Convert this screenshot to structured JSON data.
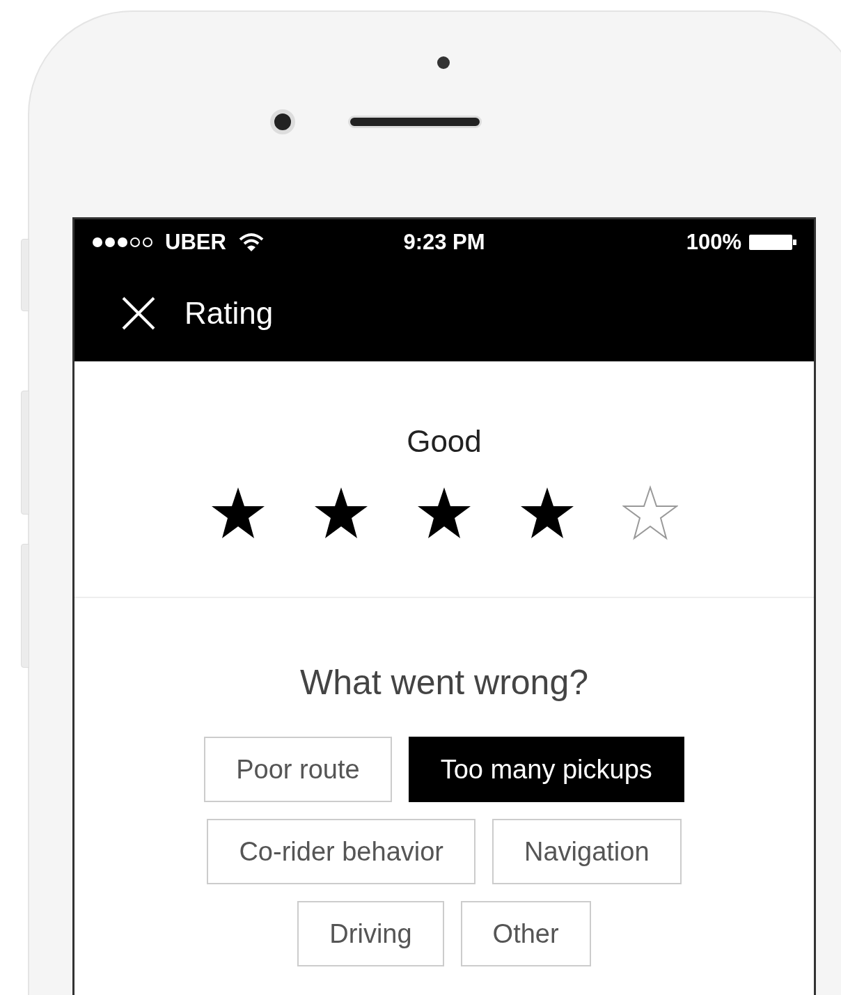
{
  "status_bar": {
    "carrier": "UBER",
    "time": "9:23 PM",
    "battery": "100%"
  },
  "nav": {
    "title": "Rating"
  },
  "rating": {
    "label": "Good",
    "stars": 4
  },
  "question": "What went wrong?",
  "options": [
    {
      "label": "Poor route",
      "selected": false
    },
    {
      "label": "Too many pickups",
      "selected": true
    },
    {
      "label": "Co-rider behavior",
      "selected": false
    },
    {
      "label": "Navigation",
      "selected": false
    },
    {
      "label": "Driving",
      "selected": false
    },
    {
      "label": "Other",
      "selected": false
    }
  ]
}
